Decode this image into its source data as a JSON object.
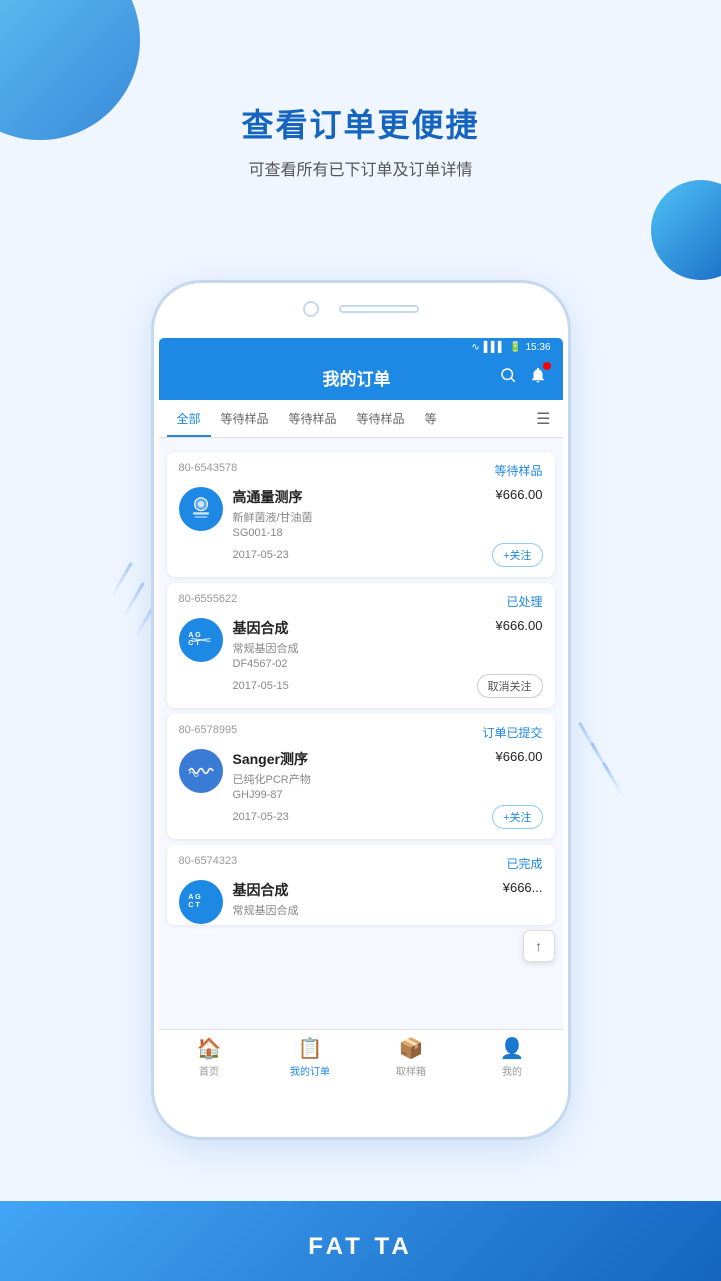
{
  "page": {
    "bg_circle_tl": "decorative",
    "bg_circle_tr": "decorative"
  },
  "header": {
    "title": "查看订单更便捷",
    "subtitle": "可查看所有已下订单及订单详情"
  },
  "phone": {
    "status_bar": {
      "time": "15:36"
    },
    "app_header": {
      "title": "我的订单"
    },
    "tabs": [
      {
        "label": "全部",
        "active": true
      },
      {
        "label": "等待样品",
        "active": false
      },
      {
        "label": "等待样品",
        "active": false
      },
      {
        "label": "等待样品",
        "active": false
      },
      {
        "label": "等",
        "active": false
      }
    ],
    "orders": [
      {
        "id": "80-6543578",
        "status": "等待样品",
        "status_class": "waiting",
        "name": "高通量测序",
        "price": "¥666.00",
        "detail1": "新鲜菌液/甘油菌",
        "detail2": "SG001-18",
        "date": "2017-05-23",
        "action": "+关注",
        "action_type": "follow",
        "icon_type": "sequencer"
      },
      {
        "id": "80-6555622",
        "status": "已处理",
        "status_class": "processed",
        "name": "基因合成",
        "price": "¥666.00",
        "detail1": "常规基因合成",
        "detail2": "DF4567-02",
        "date": "2017-05-15",
        "action": "取消关注",
        "action_type": "unfollow",
        "icon_type": "gene"
      },
      {
        "id": "80-6578995",
        "status": "订单已提交",
        "status_class": "submitted",
        "name": "Sanger测序",
        "price": "¥666.00",
        "detail1": "已纯化PCR产物",
        "detail2": "GHJ99-87",
        "date": "2017-05-23",
        "action": "+关注",
        "action_type": "follow",
        "icon_type": "sanger"
      },
      {
        "id": "80-6574323",
        "status": "已完成",
        "status_class": "done",
        "name": "基因合成",
        "price": "¥666...",
        "detail1": "常规基因合成",
        "detail2": "",
        "date": "",
        "action": "",
        "action_type": "",
        "icon_type": "gene"
      }
    ],
    "bottom_nav": [
      {
        "label": "首页",
        "icon": "🏠",
        "active": false
      },
      {
        "label": "我的订单",
        "icon": "📋",
        "active": true
      },
      {
        "label": "取样箱",
        "icon": "📦",
        "active": false
      },
      {
        "label": "我的",
        "icon": "👤",
        "active": false
      }
    ]
  },
  "brand": {
    "text": "FAT TA"
  }
}
